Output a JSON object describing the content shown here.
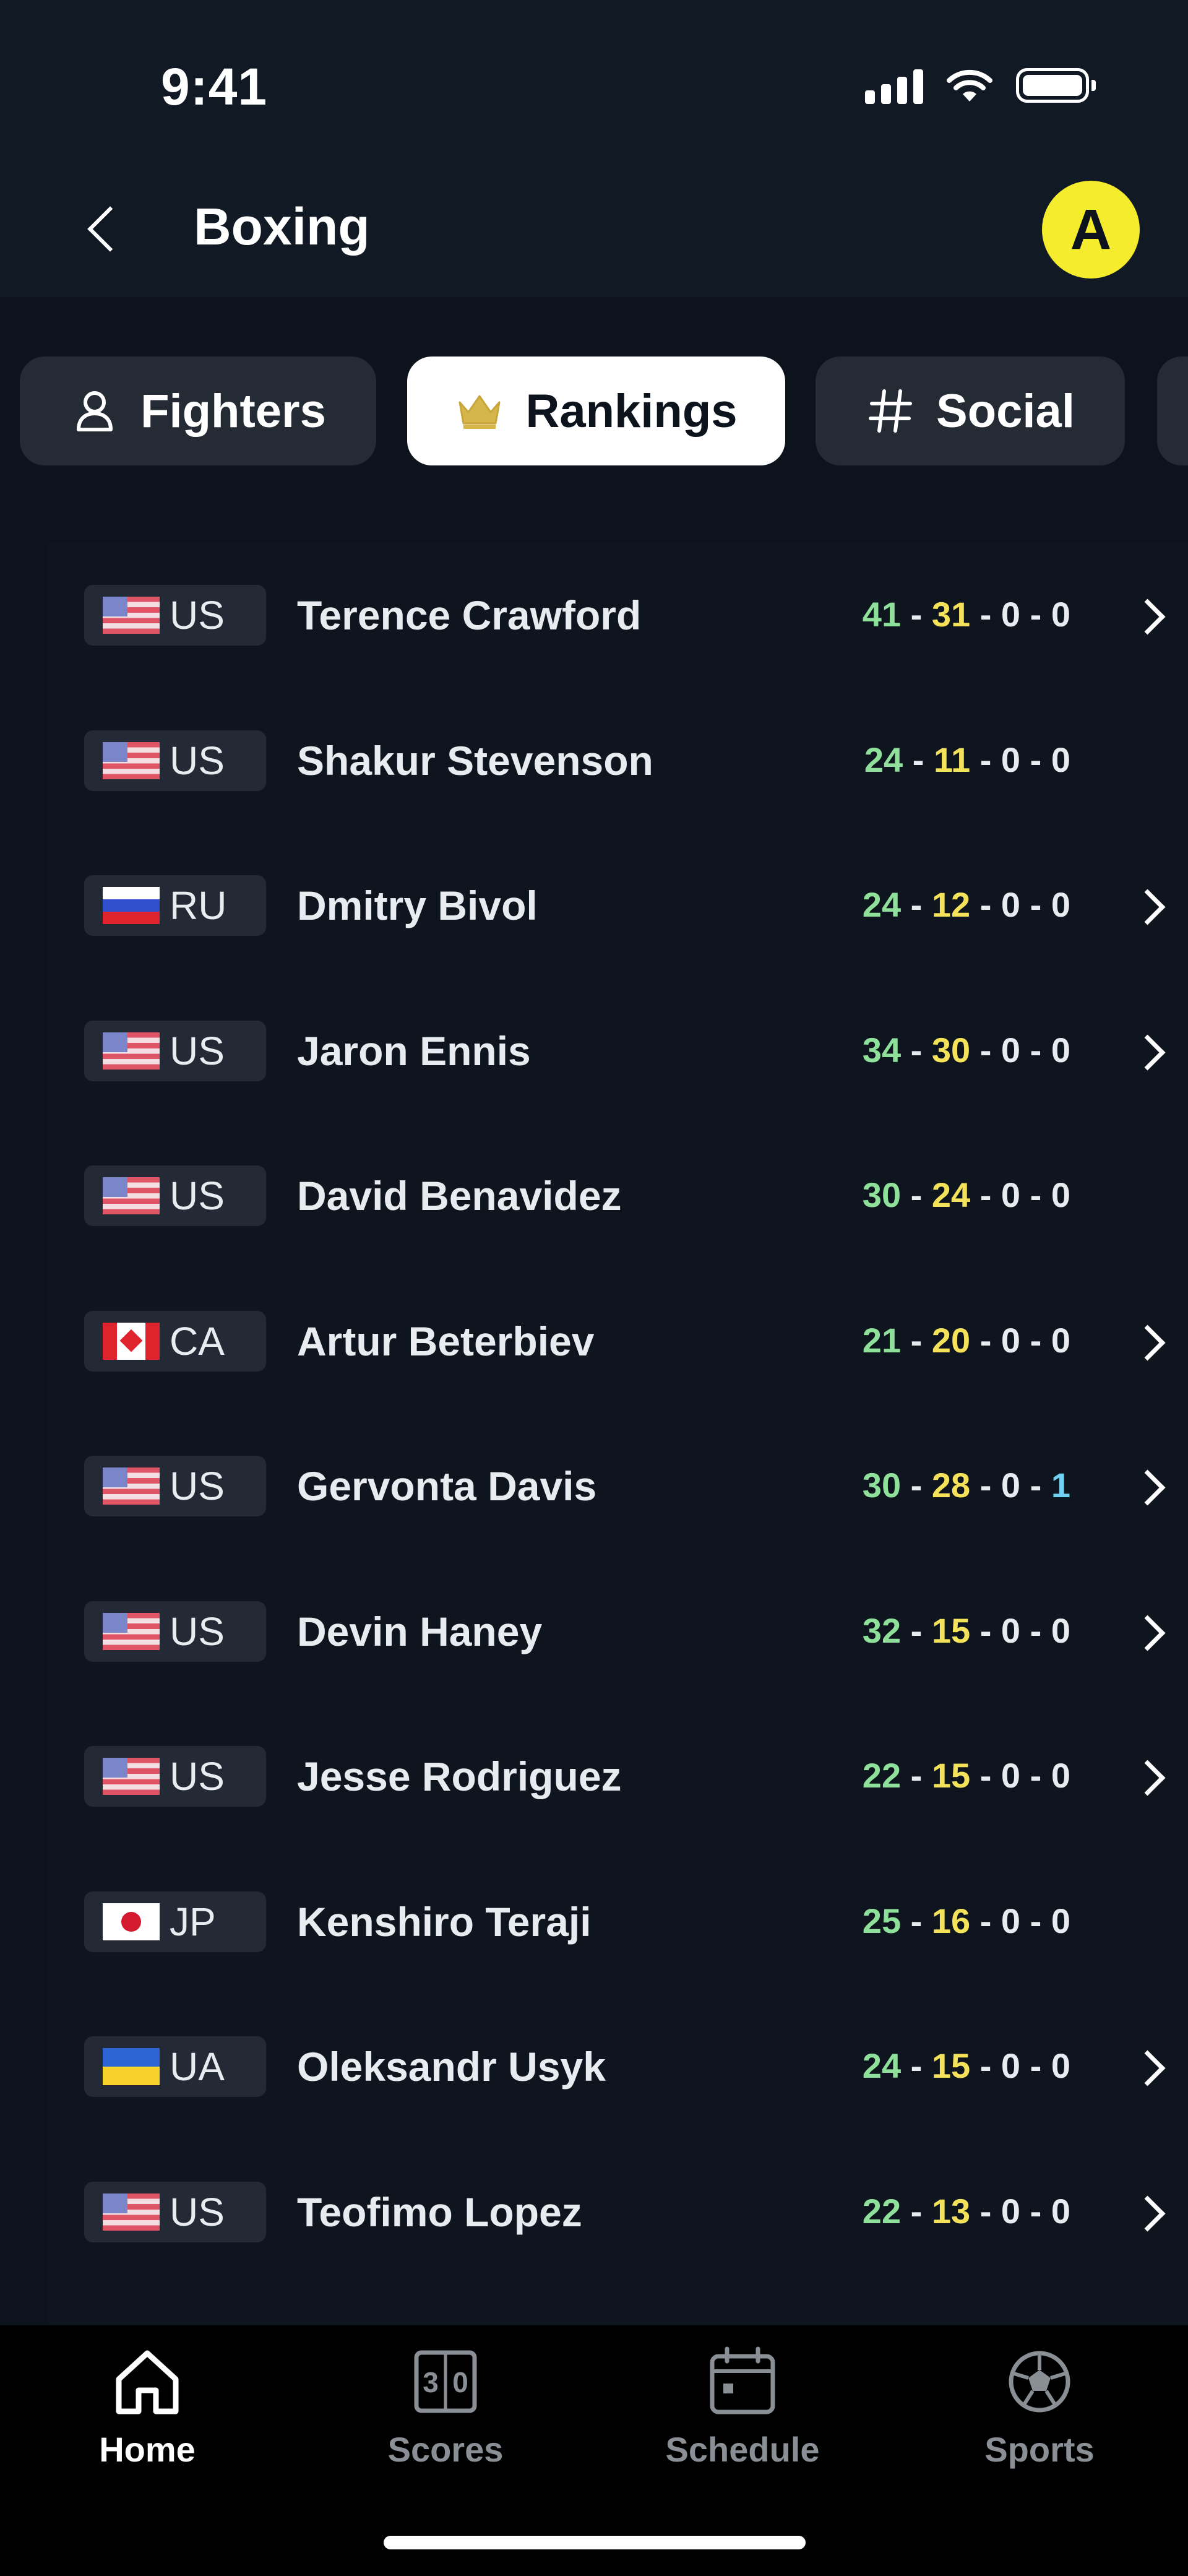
{
  "status_bar": {
    "time": "9:41"
  },
  "header": {
    "title": "Boxing",
    "avatar_initial": "A"
  },
  "tabs": [
    {
      "label": "Fighters",
      "icon": "person-icon",
      "active": false
    },
    {
      "label": "Rankings",
      "icon": "crown-icon",
      "active": true
    },
    {
      "label": "Social",
      "icon": "hashtag-icon",
      "active": false
    }
  ],
  "colors": {
    "wins": "#8fe09a",
    "losses": "#f3e25a",
    "draws": "#e8ebef",
    "no_contest_highlight": "#6fd2f0",
    "avatar": "#f4ec2c"
  },
  "fighters": [
    {
      "country": "US",
      "name": "Terence Crawford",
      "w": "41",
      "l": "31",
      "d": "0",
      "nc": "0",
      "chevron": true
    },
    {
      "country": "US",
      "name": "Shakur Stevenson",
      "w": "24",
      "l": "11",
      "d": "0",
      "nc": "0",
      "chevron": false
    },
    {
      "country": "RU",
      "name": "Dmitry Bivol",
      "w": "24",
      "l": "12",
      "d": "0",
      "nc": "0",
      "chevron": true
    },
    {
      "country": "US",
      "name": "Jaron Ennis",
      "w": "34",
      "l": "30",
      "d": "0",
      "nc": "0",
      "chevron": true
    },
    {
      "country": "US",
      "name": "David Benavidez",
      "w": "30",
      "l": "24",
      "d": "0",
      "nc": "0",
      "chevron": false
    },
    {
      "country": "CA",
      "name": "Artur Beterbiev",
      "w": "21",
      "l": "20",
      "d": "0",
      "nc": "0",
      "chevron": true
    },
    {
      "country": "US",
      "name": "Gervonta Davis",
      "w": "30",
      "l": "28",
      "d": "0",
      "nc": "1",
      "chevron": true
    },
    {
      "country": "US",
      "name": "Devin Haney",
      "w": "32",
      "l": "15",
      "d": "0",
      "nc": "0",
      "chevron": true
    },
    {
      "country": "US",
      "name": "Jesse Rodriguez",
      "w": "22",
      "l": "15",
      "d": "0",
      "nc": "0",
      "chevron": true
    },
    {
      "country": "JP",
      "name": "Kenshiro Teraji",
      "w": "25",
      "l": "16",
      "d": "0",
      "nc": "0",
      "chevron": false
    },
    {
      "country": "UA",
      "name": "Oleksandr Usyk",
      "w": "24",
      "l": "15",
      "d": "0",
      "nc": "0",
      "chevron": true
    },
    {
      "country": "US",
      "name": "Teofimo Lopez",
      "w": "22",
      "l": "13",
      "d": "0",
      "nc": "0",
      "chevron": true
    }
  ],
  "tab_bar": [
    {
      "label": "Home",
      "icon": "home-icon",
      "active": true
    },
    {
      "label": "Scores",
      "icon": "scoreboard-icon",
      "active": false
    },
    {
      "label": "Schedule",
      "icon": "calendar-icon",
      "active": false
    },
    {
      "label": "Sports",
      "icon": "soccer-ball-icon",
      "active": false
    }
  ]
}
